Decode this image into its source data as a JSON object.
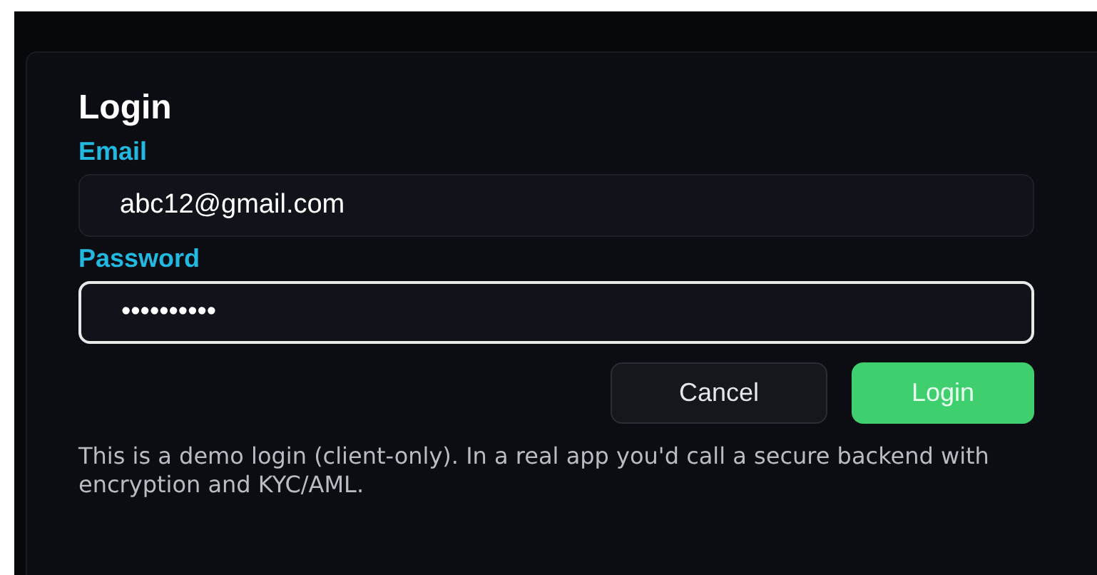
{
  "title": "Login",
  "fields": [
    {
      "label": "Email",
      "value": "abc12@gmail.com",
      "focused": false
    },
    {
      "label": "Password",
      "value": "••••••••••",
      "focused": true
    }
  ],
  "buttons": [
    {
      "label": "Cancel",
      "kind": "secondary"
    },
    {
      "label": "Login",
      "kind": "primary"
    }
  ],
  "note": "This is a demo login (client-only). In a real app you'd call a secure backend with encryption and KYC/AML."
}
